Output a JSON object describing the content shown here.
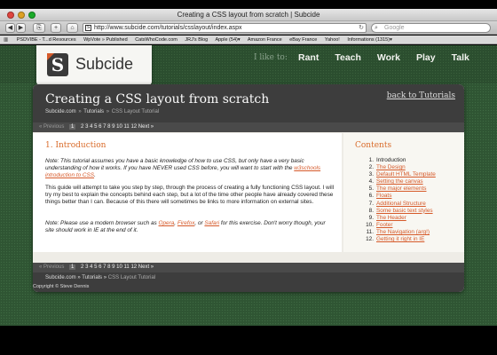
{
  "window": {
    "title": "Creating a CSS layout from scratch | Subcide"
  },
  "toolbar": {
    "back": "◀",
    "forward": "▶",
    "share": "⎘",
    "add": "+",
    "home": "⌂",
    "url": "http://www.subcide.com/tutorials/csslayout/index.aspx",
    "reload": "↻",
    "search_placeholder": "Google"
  },
  "bookmarks": [
    "PSDVIBE - T...d Resources",
    "WpVote » Published",
    "CatsWhoCode.com",
    "JRJ's Blog",
    "Apple (54)▾",
    "Amazon France",
    "eBay France",
    "Yahoo!",
    "Informations (1315)▾"
  ],
  "site": {
    "logo_text": "Subcide",
    "logo_letter": "S",
    "nav_intro": "I like to:",
    "nav": [
      "Rant",
      "Teach",
      "Work",
      "Play",
      "Talk"
    ]
  },
  "header": {
    "title": "Creating a CSS layout from scratch",
    "back_link": "back to Tutorials",
    "breadcrumb": {
      "home": "Subcide.com",
      "sep": "»",
      "section": "Tutorials",
      "current": "CSS Layout Tutorial"
    }
  },
  "pager": {
    "prev": "« Previous",
    "pages": [
      "1",
      "2",
      "3",
      "4",
      "5",
      "6",
      "7",
      "8",
      "9",
      "10",
      "11",
      "12"
    ],
    "current": "1",
    "next": "Next »"
  },
  "content": {
    "heading": "1. Introduction",
    "note1": "Note: This tutorial assumes you have a basic knowledge of how to use CSS, but only have a very basic understanding of how it works. If you have NEVER used CSS before, you will want to start with the",
    "note1_link": "w3schools introduction to CSS",
    "note1_end": ".",
    "para": "This guide will attempt to take you step by step, through the process of creating a fully functioning CSS layout. I will try my best to explain the concepts behind each step, but a lot of the time other people have already covered these things better than I can. Because of this there will sometimes be links to more information on external sites.",
    "note2_a": "Note: Please use a modern browser such as",
    "note2_links": [
      "Opera",
      "Firefox",
      "Safari"
    ],
    "note2_or": "or",
    "note2_b": "for this exercise. Don't worry though, your site should work in IE at the end of it."
  },
  "toc": {
    "title": "Contents",
    "items": [
      "Introduction",
      "The Design",
      "Default HTML Template",
      "Setting the canvas",
      "The major elements",
      "Floats",
      "Additional Structure",
      "Some basic text styles",
      "The Header",
      "Footer",
      "The Navigation (arg!)",
      "Getting it right in IE"
    ]
  },
  "footer": {
    "breadcrumb": {
      "home": "Subcide.com",
      "sep": "»",
      "section": "Tutorials",
      "current": "CSS Layout Tutorial"
    },
    "copyright": "Copyright © Steve Dennis"
  },
  "colors": {
    "accent": "#d96b2a",
    "page_bg": "#2f5533",
    "header_bg": "#3d3d3d"
  }
}
